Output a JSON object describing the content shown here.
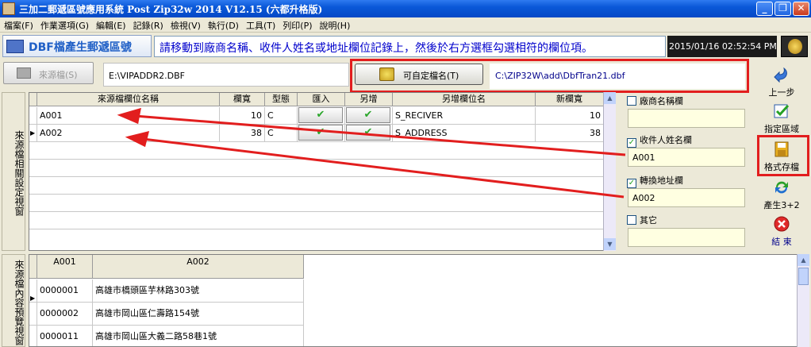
{
  "window": {
    "title": "三加二郵遞區號應用系統  Post Zip32w 2014  V12.15 (六都升格版)",
    "minimize": "_",
    "restore": "❐",
    "close": "✕"
  },
  "menu": [
    "檔案(F)",
    "作業選項(G)",
    "編輯(E)",
    "記錄(R)",
    "檢視(V)",
    "執行(D)",
    "工具(T)",
    "列印(P)",
    "說明(H)"
  ],
  "banner": {
    "logo_text": "DBF檔產生郵遞區號",
    "message": "請移動到廠商名稱、收件人姓名或地址欄位記錄上，然後於右方選框勾選相符的欄位項。",
    "datetime": "2015/01/16 02:52:54 PM"
  },
  "source": {
    "button_label": "來源檔(S)",
    "path": "E:\\VIPADDR2.DBF"
  },
  "target": {
    "button_label": "可自定檔名(T)",
    "path": "C:\\ZIP32W\\add\\DbfTran21.dbf"
  },
  "toolbar": [
    {
      "label": "上一步",
      "icon": "back-arrow-icon"
    },
    {
      "label": "指定區域",
      "icon": "checklist-icon"
    },
    {
      "label": "格式存檔",
      "icon": "floppy-save-icon"
    },
    {
      "label": "產生3+2",
      "icon": "refresh-icon"
    },
    {
      "label": "結  束",
      "icon": "close-circle-icon"
    }
  ],
  "left_labels": {
    "top": "來源檔相關設定視窗",
    "bottom": "來源檔內容預覽視窗"
  },
  "field_grid": {
    "columns": [
      "來源檔欄位名稱",
      "欄寬",
      "型態",
      "匯入",
      "另增",
      "另增欄位名",
      "新欄寬"
    ],
    "rows": [
      {
        "name": "A001",
        "width": "10",
        "type": "C",
        "import_checked": true,
        "add_checked": true,
        "new_name": "S_RECIVER",
        "new_width": "10"
      },
      {
        "name": "A002",
        "width": "38",
        "type": "C",
        "import_checked": true,
        "add_checked": true,
        "new_name": "S_ADDRESS",
        "new_width": "38"
      }
    ]
  },
  "side_options": [
    {
      "label": "廠商名稱欄",
      "checked": false,
      "value": ""
    },
    {
      "label": "收件人姓名欄",
      "checked": true,
      "value": "A001"
    },
    {
      "label": "轉換地址欄",
      "checked": true,
      "value": "A002"
    },
    {
      "label": "其它",
      "checked": false,
      "value": ""
    }
  ],
  "data_grid": {
    "columns": [
      "A001",
      "A002"
    ],
    "rows": [
      [
        "0000001",
        "高雄市橋頭區芋林路303號"
      ],
      [
        "0000002",
        "高雄市岡山區仁壽路154號"
      ],
      [
        "0000011",
        "高雄市岡山區大義二路58巷1號"
      ]
    ]
  },
  "colors": {
    "annotation_red": "#e21e1e",
    "title_blue": "#0a58d8",
    "message_text": "#0000cc"
  }
}
